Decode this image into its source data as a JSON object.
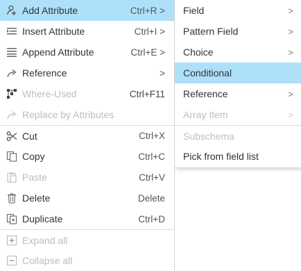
{
  "main_menu": {
    "add_attribute": {
      "label": "Add Attribute",
      "shortcut": "Ctrl+R >"
    },
    "insert_attribute": {
      "label": "Insert Attribute",
      "shortcut": "Ctrl+I >"
    },
    "append_attribute": {
      "label": "Append Attribute",
      "shortcut": "Ctrl+E >"
    },
    "reference": {
      "label": "Reference",
      "shortcut": ">"
    },
    "where_used": {
      "label": "Where-Used",
      "shortcut": "Ctrl+F11"
    },
    "replace_by_attributes": {
      "label": "Replace by Attributes"
    },
    "cut": {
      "label": "Cut",
      "shortcut": "Ctrl+X"
    },
    "copy": {
      "label": "Copy",
      "shortcut": "Ctrl+C"
    },
    "paste": {
      "label": "Paste",
      "shortcut": "Ctrl+V"
    },
    "delete": {
      "label": "Delete",
      "shortcut": "Delete"
    },
    "duplicate": {
      "label": "Duplicate",
      "shortcut": "Ctrl+D"
    },
    "expand_all": {
      "label": "Expand all"
    },
    "collapse_all": {
      "label": "Collapse all"
    }
  },
  "sub_menu": {
    "field": {
      "label": "Field",
      "arrow": ">"
    },
    "pattern_field": {
      "label": "Pattern Field",
      "arrow": ">"
    },
    "choice": {
      "label": "Choice",
      "arrow": ">"
    },
    "conditional": {
      "label": "Conditional"
    },
    "reference": {
      "label": "Reference",
      "arrow": ">"
    },
    "array_item": {
      "label": "Array Item",
      "arrow": ">"
    },
    "subschema": {
      "label": "Subschema"
    },
    "pick_from_field_list": {
      "label": "Pick from field list"
    }
  },
  "colors": {
    "highlight": "#aee0fa",
    "disabled": "#bdbdbd",
    "separator": "#dcdcdc"
  }
}
